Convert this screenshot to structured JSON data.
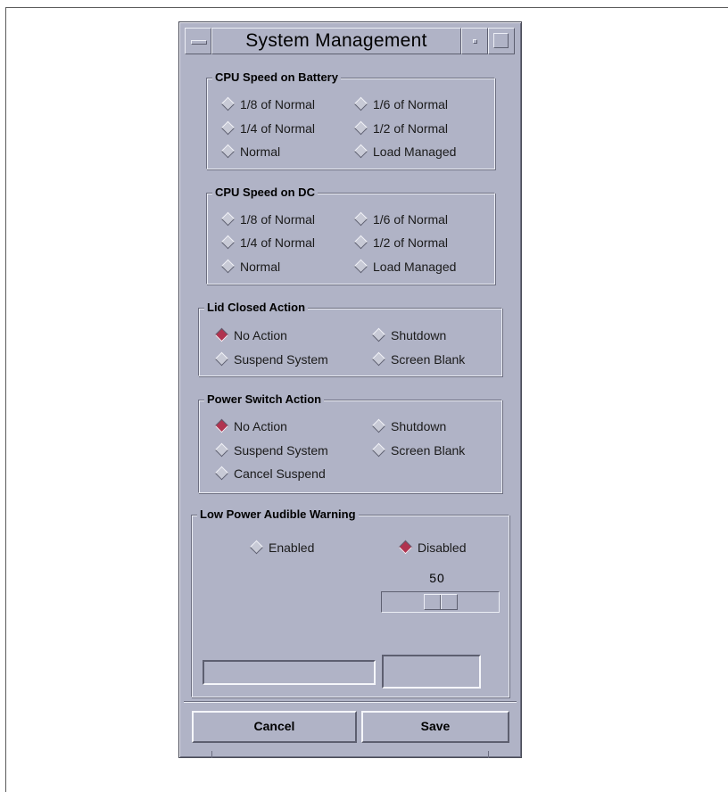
{
  "window": {
    "title": "System Management"
  },
  "groups": {
    "cpu_battery": {
      "title": "CPU Speed on Battery",
      "options": [
        "1/8 of Normal",
        "1/6 of Normal",
        "1/4 of Normal",
        "1/2 of Normal",
        "Normal",
        "Load Managed"
      ],
      "selected": null
    },
    "cpu_dc": {
      "title": "CPU Speed on DC",
      "options": [
        "1/8 of Normal",
        "1/6 of Normal",
        "1/4 of Normal",
        "1/2 of Normal",
        "Normal",
        "Load Managed"
      ],
      "selected": null
    },
    "lid_closed": {
      "title": "Lid Closed Action",
      "options": [
        "No Action",
        "Shutdown",
        "Suspend System",
        "Screen Blank"
      ],
      "selected": "No Action"
    },
    "power_switch": {
      "title": "Power Switch Action",
      "options": [
        "No Action",
        "Shutdown",
        "Suspend System",
        "Screen Blank",
        "Cancel Suspend"
      ],
      "selected": "No Action"
    },
    "low_power": {
      "title": "Low Power Audible Warning",
      "options": [
        "Enabled",
        "Disabled"
      ],
      "selected": "Disabled",
      "scale_value": "50",
      "scale_fraction": 0.5
    }
  },
  "buttons": {
    "cancel": "Cancel",
    "save": "Save"
  },
  "colors": {
    "window_bg": "#b0b3c6",
    "radio_selected": "#b0334f",
    "radio_unselected": "#c8cad6"
  }
}
